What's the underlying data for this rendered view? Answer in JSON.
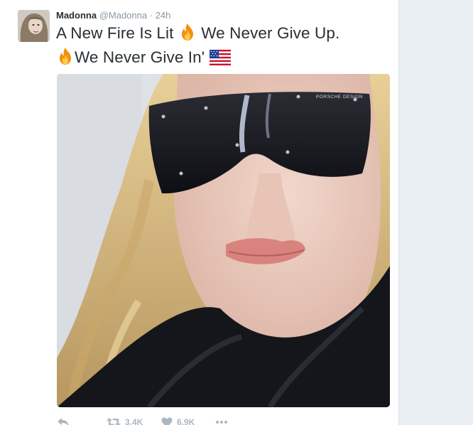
{
  "tweet": {
    "author_name": "Madonna",
    "author_handle": "@Madonna",
    "separator": "·",
    "time": "24h",
    "text_line1_a": "A New Fire Is Lit",
    "text_line1_b": "We Never Give Up.",
    "text_line2": "We Never Give In'",
    "emojis": [
      "fire-emoji",
      "fire-emoji",
      "us-flag-emoji"
    ],
    "image": {
      "printed_brand": "PORSCHE DESIGN"
    }
  },
  "actions": {
    "reply_icon": "reply-icon",
    "retweet_icon": "retweet-icon",
    "retweet_count": "3.4K",
    "like_icon": "heart-icon",
    "like_count": "6.9K",
    "more_icon": "more-icon"
  },
  "colors": {
    "text": "#292f33",
    "secondary": "#8899a6",
    "action": "#aab8c2",
    "page_bg": "#e8eef2"
  }
}
